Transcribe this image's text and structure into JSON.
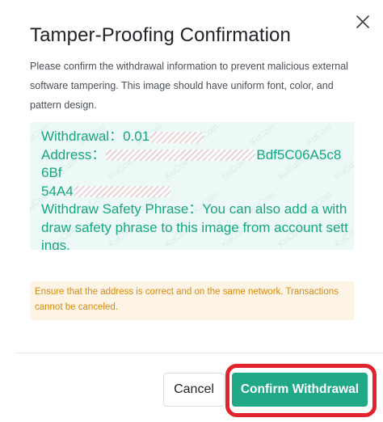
{
  "dialog": {
    "title": "Tamper-Proofing Confirmation",
    "description": "Please confirm the withdrawal information to prevent malicious external software tampering. This image should have uniform font, color, and pattern design."
  },
  "info": {
    "withdrawal_label": "Withdrawal：",
    "withdrawal_value": "0.01",
    "address_label": "Address：",
    "address_visible_end": "Bdf5C06A5c86Bf",
    "address_line2_start": "54A4",
    "safety_phrase": "Withdraw Safety Phrase：You can also add a withdraw safety phrase to this image from account settings.",
    "watermark_text": "KuCoin",
    "text_color": "#15a582",
    "background_color": "#edf9f6"
  },
  "warning": {
    "text": "Ensure that the address is correct and on the same network. Transactions cannot be canceled.",
    "color": "#d98a0a"
  },
  "buttons": {
    "cancel_label": "Cancel",
    "confirm_label": "Confirm Withdrawal",
    "confirm_color": "#1fa986",
    "highlight_color": "#e2222c"
  },
  "icons": {
    "close": "close-icon"
  }
}
